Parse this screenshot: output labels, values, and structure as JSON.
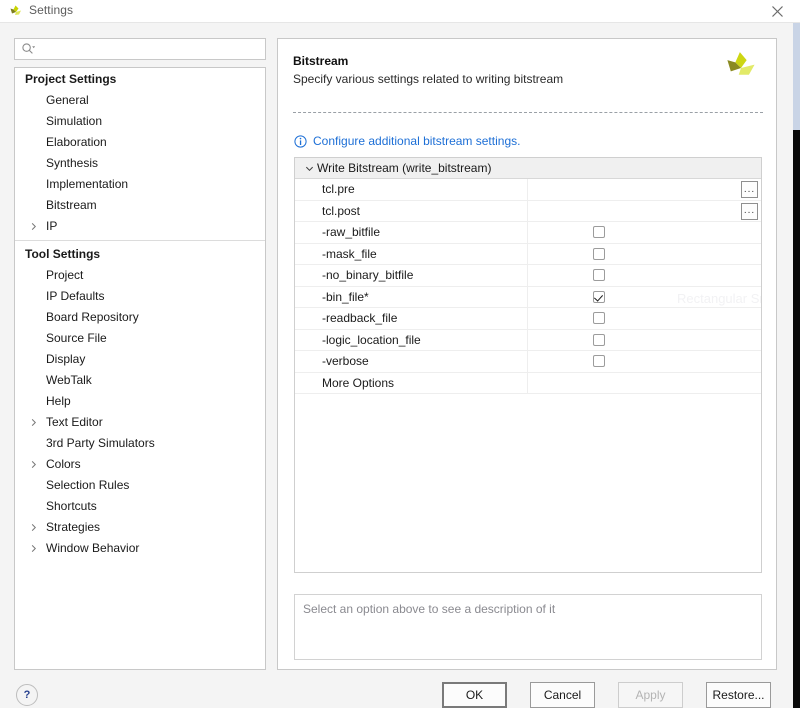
{
  "window": {
    "title": "Settings",
    "app_icon": "vivado-logo-icon",
    "close_label": "×"
  },
  "search": {
    "placeholder": "",
    "value": "",
    "icon": "search-icon"
  },
  "sidebar": {
    "groups": [
      {
        "title": "Project Settings",
        "items": [
          {
            "label": "General",
            "expandable": false
          },
          {
            "label": "Simulation",
            "expandable": false
          },
          {
            "label": "Elaboration",
            "expandable": false
          },
          {
            "label": "Synthesis",
            "expandable": false
          },
          {
            "label": "Implementation",
            "expandable": false
          },
          {
            "label": "Bitstream",
            "expandable": false
          },
          {
            "label": "IP",
            "expandable": true
          }
        ]
      },
      {
        "title": "Tool Settings",
        "items": [
          {
            "label": "Project",
            "expandable": false
          },
          {
            "label": "IP Defaults",
            "expandable": false
          },
          {
            "label": "Board Repository",
            "expandable": false
          },
          {
            "label": "Source File",
            "expandable": false
          },
          {
            "label": "Display",
            "expandable": false
          },
          {
            "label": "WebTalk",
            "expandable": false
          },
          {
            "label": "Help",
            "expandable": false
          },
          {
            "label": "Text Editor",
            "expandable": true
          },
          {
            "label": "3rd Party Simulators",
            "expandable": false
          },
          {
            "label": "Colors",
            "expandable": true
          },
          {
            "label": "Selection Rules",
            "expandable": false
          },
          {
            "label": "Shortcuts",
            "expandable": false
          },
          {
            "label": "Strategies",
            "expandable": true
          },
          {
            "label": "Window Behavior",
            "expandable": true
          }
        ]
      }
    ]
  },
  "panel": {
    "title": "Bitstream",
    "subtitle": "Specify various settings related to writing bitstream",
    "logo": "vivado-logo-icon",
    "info_link": "Configure additional bitstream settings.",
    "info_icon": "info-circle-icon",
    "link_color": "#1d6fd6"
  },
  "options_table": {
    "group_label": "Write Bitstream (write_bitstream)",
    "group_expanded": true,
    "rows": [
      {
        "label": "tcl.pre",
        "control": "text",
        "value": "",
        "browse": "..."
      },
      {
        "label": "tcl.post",
        "control": "text",
        "value": "",
        "browse": "..."
      },
      {
        "label": "-raw_bitfile",
        "control": "checkbox",
        "checked": false
      },
      {
        "label": "-mask_file",
        "control": "checkbox",
        "checked": false
      },
      {
        "label": "-no_binary_bitfile",
        "control": "checkbox",
        "checked": false
      },
      {
        "label": "-bin_file*",
        "control": "checkbox",
        "checked": true
      },
      {
        "label": "-readback_file",
        "control": "checkbox",
        "checked": false
      },
      {
        "label": "-logic_location_file",
        "control": "checkbox",
        "checked": false
      },
      {
        "label": "-verbose",
        "control": "checkbox",
        "checked": false
      },
      {
        "label": "More Options",
        "control": "none"
      }
    ],
    "watermark_text": "Rectangular Snip"
  },
  "description": {
    "text": "Select an option above to see a description of it"
  },
  "footer": {
    "help_label": "?",
    "buttons": [
      {
        "label": "OK",
        "state": "default"
      },
      {
        "label": "Cancel",
        "state": "normal"
      },
      {
        "label": "Apply",
        "state": "disabled"
      },
      {
        "label": "Restore...",
        "state": "normal"
      }
    ]
  }
}
